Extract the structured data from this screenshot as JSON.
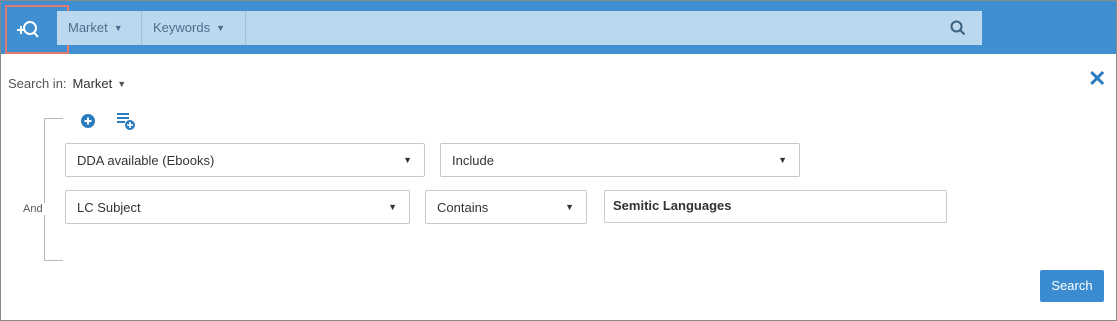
{
  "header": {
    "scope_dropdown": "Market",
    "field_dropdown": "Keywords"
  },
  "search_in": {
    "label": "Search in:",
    "value": "Market"
  },
  "conditions_group": {
    "operator": "And",
    "rows": [
      {
        "field": "DDA available (Ebooks)",
        "operator": "Include"
      },
      {
        "field": "LC Subject",
        "operator": "Contains",
        "value": "Semitic Languages"
      }
    ]
  },
  "actions": {
    "search_button": "Search"
  },
  "icons": {
    "advanced_search": "advanced-search-icon",
    "search": "magnifier-icon",
    "close": "close-icon",
    "add_condition": "plus-circle-icon",
    "add_group": "add-list-icon"
  },
  "colors": {
    "topbar": "#3f8fd1",
    "searchbar": "#bcd8ee",
    "accent": "#3a8bd0",
    "highlight": "#e07a73"
  }
}
